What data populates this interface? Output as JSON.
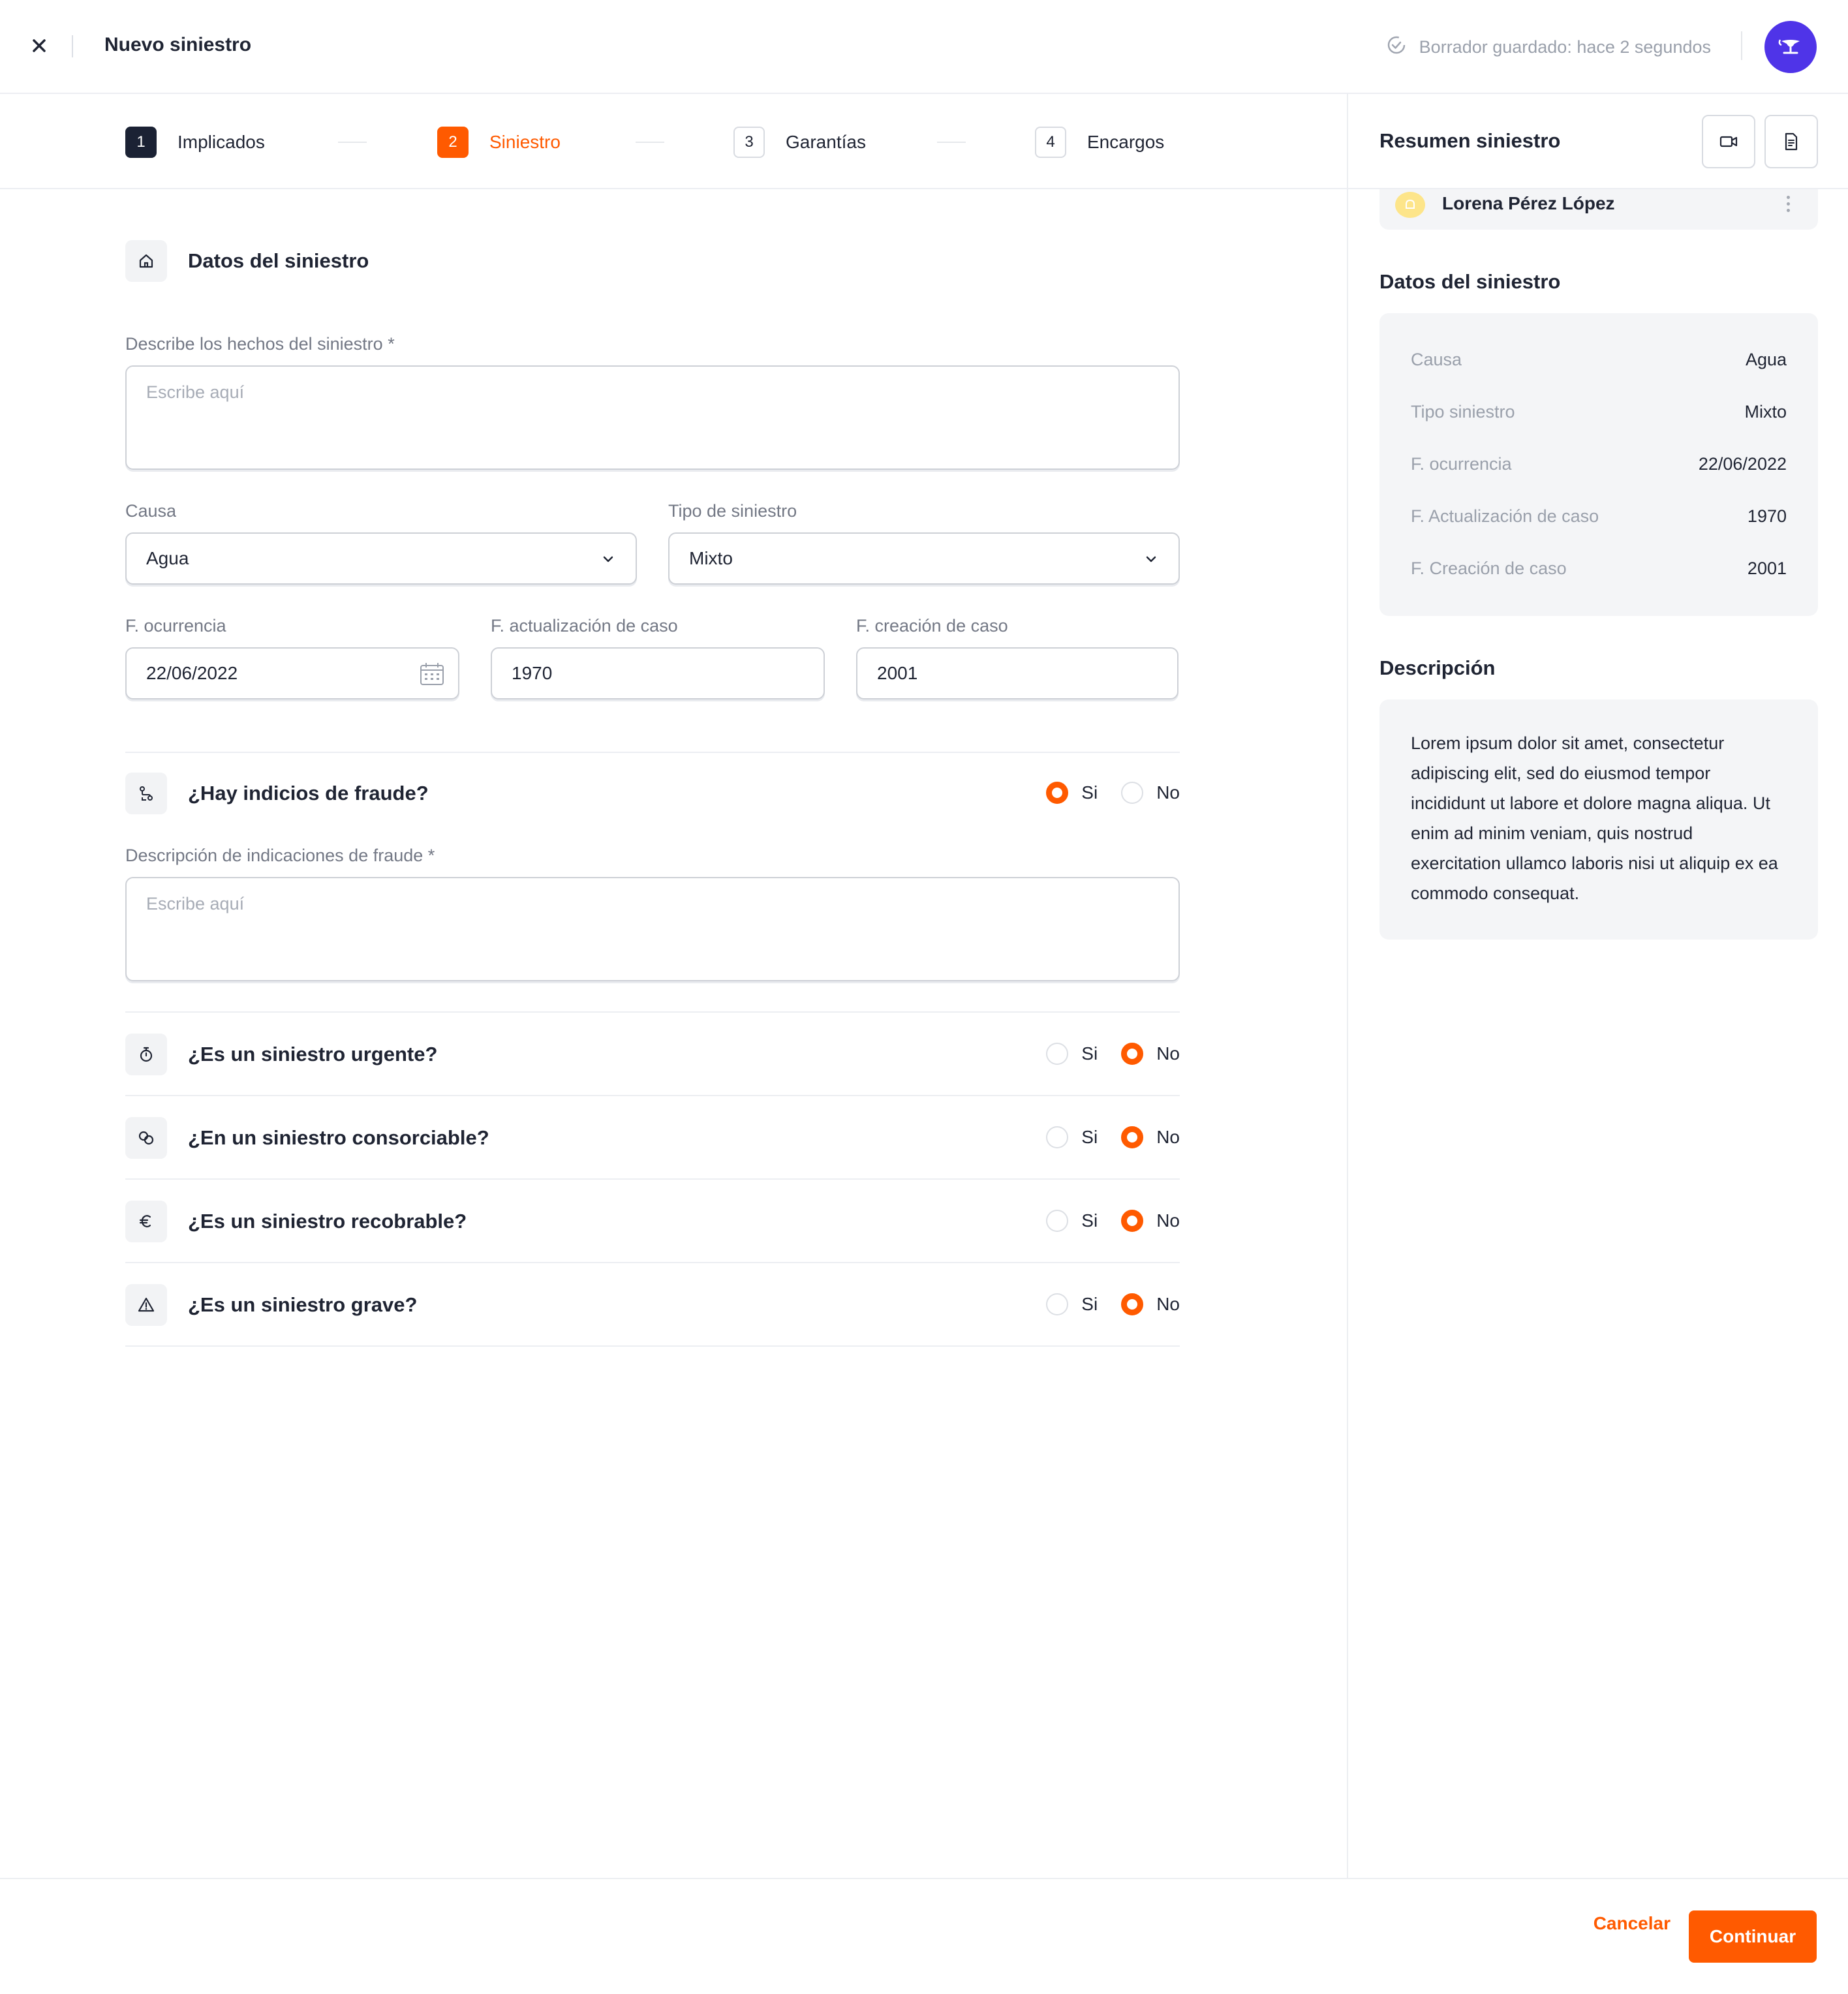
{
  "header": {
    "title": "Nuevo siniestro",
    "draft_status": "Borrador guardado: hace 2 segundos"
  },
  "stepper": {
    "steps": [
      {
        "number": "1",
        "label": "Implicados",
        "state": "done"
      },
      {
        "number": "2",
        "label": "Siniestro",
        "state": "active"
      },
      {
        "number": "3",
        "label": "Garantías",
        "state": "pending"
      },
      {
        "number": "4",
        "label": "Encargos",
        "state": "pending"
      }
    ]
  },
  "form": {
    "section_title": "Datos del siniestro",
    "hechos": {
      "label": "Describe los hechos del siniestro *",
      "placeholder": "Escribe aquí"
    },
    "causa": {
      "label": "Causa",
      "value": "Agua"
    },
    "tipo": {
      "label": "Tipo de siniestro",
      "value": "Mixto"
    },
    "f_ocurrencia": {
      "label": "F. ocurrencia",
      "value": "22/06/2022"
    },
    "f_actualizacion": {
      "label": "F. actualización de caso",
      "value": "1970"
    },
    "f_creacion": {
      "label": "F. creación de caso",
      "value": "2001"
    },
    "fraude": {
      "question": "¿Hay indicios de fraude?",
      "yes": "Si",
      "no": "No",
      "selected": "yes",
      "desc_label": "Descripción de indicaciones de fraude *",
      "desc_placeholder": "Escribe aquí"
    },
    "questions": [
      {
        "text": "¿Es un siniestro urgente?",
        "yes": "Si",
        "no": "No",
        "selected": "no",
        "icon": "stopwatch-icon"
      },
      {
        "text": "¿En un siniestro consorciable?",
        "yes": "Si",
        "no": "No",
        "selected": "no",
        "icon": "link-icon"
      },
      {
        "text": "¿Es un siniestro recobrable?",
        "yes": "Si",
        "no": "No",
        "selected": "no",
        "icon": "euro-icon"
      },
      {
        "text": "¿Es un siniestro grave?",
        "yes": "Si",
        "no": "No",
        "selected": "no",
        "icon": "warning-icon"
      }
    ]
  },
  "summary": {
    "title": "Resumen siniestro",
    "person": "Lorena Pérez López",
    "data_title": "Datos del siniestro",
    "rows": [
      {
        "key": "Causa",
        "value": "Agua"
      },
      {
        "key": "Tipo siniestro",
        "value": "Mixto"
      },
      {
        "key": "F. ocurrencia",
        "value": "22/06/2022"
      },
      {
        "key": "F. Actualización de caso",
        "value": "1970"
      },
      {
        "key": "F. Creación de caso",
        "value": "2001"
      }
    ],
    "description_title": "Descripción",
    "description": "Lorem ipsum dolor sit amet, consectetur adipiscing elit, sed do eiusmod tempor incididunt ut labore et dolore magna aliqua. Ut enim ad minim veniam, quis nostrud exercitation ullamco laboris nisi ut aliquip ex ea commodo consequat."
  },
  "footer": {
    "cancel": "Cancelar",
    "continue": "Continuar"
  },
  "colors": {
    "accent": "#ff5a00",
    "dark": "#1b2234",
    "avatar": "#4f34e8",
    "person_badge": "#fde58a"
  }
}
